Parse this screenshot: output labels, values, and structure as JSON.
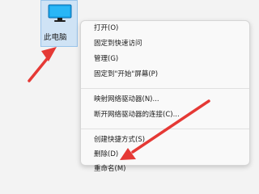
{
  "desktop_icon": {
    "label": "此电脑",
    "icon": "monitor-icon"
  },
  "context_menu": {
    "items": [
      {
        "label": "打开(O)"
      },
      {
        "label": "固定到快速访问"
      },
      {
        "label": "管理(G)"
      },
      {
        "label": "固定到\"开始\"屏幕(P)"
      },
      {
        "label": "映射网络驱动器(N)..."
      },
      {
        "label": "断开网络驱动器的连接(C)..."
      },
      {
        "label": "创建快捷方式(S)"
      },
      {
        "label": "删除(D)"
      },
      {
        "label": "重命名(M)"
      }
    ]
  },
  "annotations": {
    "arrow_color": "#e53935"
  }
}
